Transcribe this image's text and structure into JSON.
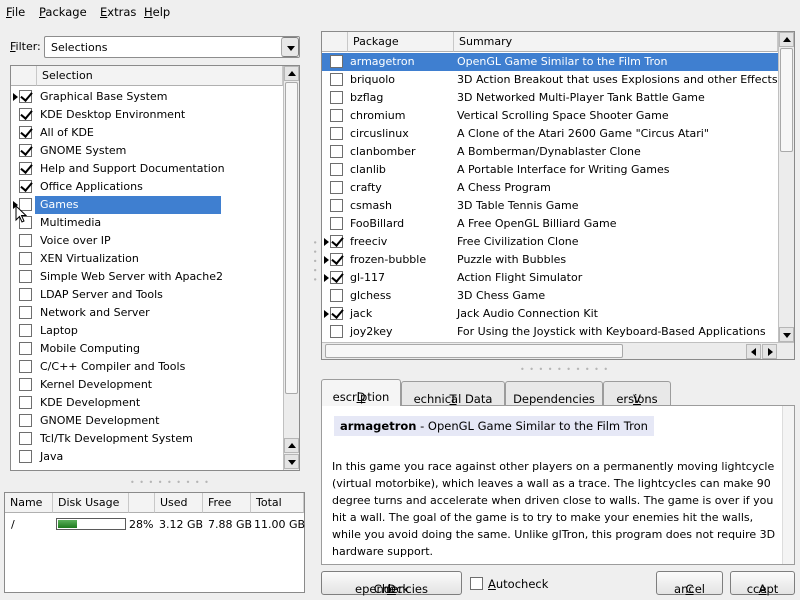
{
  "menubar": {
    "items": [
      {
        "ul": "F",
        "rest": "ile"
      },
      {
        "ul": "P",
        "rest": "ackage"
      },
      {
        "ul": "E",
        "rest": "xtras"
      },
      {
        "ul": "H",
        "rest": "elp"
      }
    ]
  },
  "filter": {
    "label_ul": "F",
    "label_rest": "ilter:",
    "value": "Selections"
  },
  "selections": {
    "header": "Selection",
    "items": [
      {
        "label": "Graphical Base System",
        "state": "checked",
        "expandable": true
      },
      {
        "label": "KDE Desktop Environment",
        "state": "checked",
        "expandable": false
      },
      {
        "label": "All of KDE",
        "state": "checked",
        "expandable": false
      },
      {
        "label": "GNOME System",
        "state": "checked",
        "expandable": false
      },
      {
        "label": "Help and Support Documentation",
        "state": "checked",
        "expandable": false
      },
      {
        "label": "Office Applications",
        "state": "checked",
        "expandable": false
      },
      {
        "label": "Games",
        "state": "selected",
        "expandable": true
      },
      {
        "label": "Multimedia",
        "state": "unchecked",
        "expandable": false
      },
      {
        "label": "Voice over IP",
        "state": "unchecked",
        "expandable": false
      },
      {
        "label": "XEN Virtualization",
        "state": "unchecked",
        "expandable": false
      },
      {
        "label": "Simple Web Server with Apache2",
        "state": "unchecked",
        "expandable": false
      },
      {
        "label": "LDAP Server and Tools",
        "state": "unchecked",
        "expandable": false
      },
      {
        "label": "Network and Server",
        "state": "unchecked",
        "expandable": false
      },
      {
        "label": "Laptop",
        "state": "unchecked",
        "expandable": false
      },
      {
        "label": "Mobile Computing",
        "state": "unchecked",
        "expandable": false
      },
      {
        "label": "C/C++ Compiler and Tools",
        "state": "unchecked",
        "expandable": false
      },
      {
        "label": "Kernel Development",
        "state": "unchecked",
        "expandable": false
      },
      {
        "label": "KDE Development",
        "state": "unchecked",
        "expandable": false
      },
      {
        "label": "GNOME Development",
        "state": "unchecked",
        "expandable": false
      },
      {
        "label": "Tcl/Tk Development System",
        "state": "unchecked",
        "expandable": false
      },
      {
        "label": "Java",
        "state": "unchecked",
        "expandable": false
      }
    ]
  },
  "disk": {
    "headers": [
      "Name",
      "Disk Usage",
      "Used",
      "Free",
      "Total"
    ],
    "rows": [
      {
        "name": "/",
        "percent": "28%",
        "usage_fraction": 0.28,
        "used": "3.12 GB",
        "free": "7.88 GB",
        "total": "11.00 GB"
      }
    ]
  },
  "packages": {
    "headers": [
      "Package",
      "Summary"
    ],
    "items": [
      {
        "name": "armagetron",
        "summary": "OpenGL Game Similar to the Film Tron",
        "checked": false,
        "selected": true,
        "expandable": false
      },
      {
        "name": "briquolo",
        "summary": "3D Action Breakout that uses Explosions and other Effects",
        "checked": false,
        "selected": false,
        "expandable": false
      },
      {
        "name": "bzflag",
        "summary": "3D Networked Multi-Player Tank Battle Game",
        "checked": false,
        "selected": false,
        "expandable": false
      },
      {
        "name": "chromium",
        "summary": "Vertical Scrolling Space Shooter Game",
        "checked": false,
        "selected": false,
        "expandable": false
      },
      {
        "name": "circuslinux",
        "summary": "A Clone of the Atari 2600 Game \"Circus Atari\"",
        "checked": false,
        "selected": false,
        "expandable": false
      },
      {
        "name": "clanbomber",
        "summary": "A Bomberman/Dynablaster Clone",
        "checked": false,
        "selected": false,
        "expandable": false
      },
      {
        "name": "clanlib",
        "summary": "A Portable Interface for Writing Games",
        "checked": false,
        "selected": false,
        "expandable": false
      },
      {
        "name": "crafty",
        "summary": "A Chess Program",
        "checked": false,
        "selected": false,
        "expandable": false
      },
      {
        "name": "csmash",
        "summary": "3D Table Tennis Game",
        "checked": false,
        "selected": false,
        "expandable": false
      },
      {
        "name": "FooBillard",
        "summary": "A Free OpenGL Billiard Game",
        "checked": false,
        "selected": false,
        "expandable": false
      },
      {
        "name": "freeciv",
        "summary": "Free Civilization Clone",
        "checked": true,
        "selected": false,
        "expandable": true
      },
      {
        "name": "frozen-bubble",
        "summary": "Puzzle with Bubbles",
        "checked": true,
        "selected": false,
        "expandable": true
      },
      {
        "name": "gl-117",
        "summary": "Action Flight Simulator",
        "checked": true,
        "selected": false,
        "expandable": true
      },
      {
        "name": "glchess",
        "summary": "3D Chess Game",
        "checked": false,
        "selected": false,
        "expandable": false
      },
      {
        "name": "jack",
        "summary": "Jack Audio Connection Kit",
        "checked": true,
        "selected": false,
        "expandable": true
      },
      {
        "name": "joy2key",
        "summary": "For Using the Joystick with Keyboard-Based Applications",
        "checked": false,
        "selected": false,
        "expandable": false
      }
    ]
  },
  "tabs": [
    {
      "ul": "D",
      "rest": "escription",
      "active": true
    },
    {
      "ul": "T",
      "rest": "echnical Data",
      "active": false
    },
    {
      "ul": "",
      "rest": "Dependencies",
      "active": false
    },
    {
      "ul": "V",
      "rest": "ersions",
      "active": false
    }
  ],
  "description": {
    "name": "armagetron",
    "title_rest": " - OpenGL Game Similar to the Film Tron",
    "body": "In this game you race against other players on a permanently moving lightcycle (virtual motorbike), which leaves a wall as a trace. The lightcycles can make 90 degree turns and accelerate when driven close to walls. The game is over if you hit a wall. The goal of the game is to try to make your enemies hit the walls, while you avoid doing the same. Unlike glTron, this program does not require 3D hardware support."
  },
  "buttons": {
    "check_deps_pre": "Check ",
    "check_deps_ul": "D",
    "check_deps_post": "ependencies",
    "autocheck_ul": "A",
    "autocheck_rest": "utocheck",
    "cancel_ul": "C",
    "cancel_rest": "ancel",
    "accept_ul": "A",
    "accept_rest": "ccept"
  },
  "colors": {
    "selection": "#3f7fd0",
    "usage_bar": "#2e8b2e"
  }
}
